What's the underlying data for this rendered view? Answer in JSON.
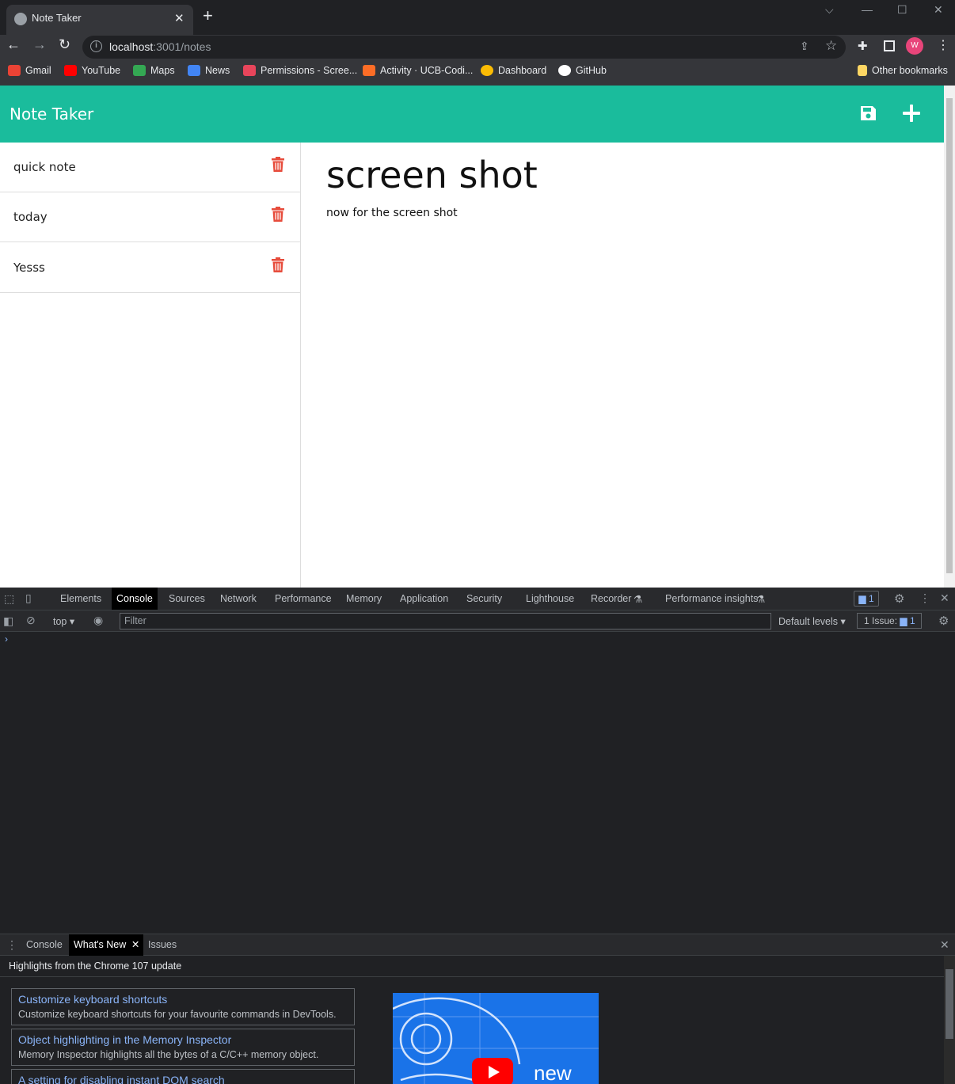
{
  "browser": {
    "tab_title": "Note Taker",
    "url_host": "localhost",
    "url_path": ":3001/notes",
    "profile_initial": "W",
    "bookmarks": [
      {
        "label": "Gmail",
        "color": "#ea4335"
      },
      {
        "label": "YouTube",
        "color": "#ff0000"
      },
      {
        "label": "Maps",
        "color": "#34a853"
      },
      {
        "label": "News",
        "color": "#4285f4"
      },
      {
        "label": "Permissions - Scree...",
        "color": "#e8455b"
      },
      {
        "label": "Activity · UCB-Codi...",
        "color": "#fc6d26"
      },
      {
        "label": "Dashboard",
        "color": "#fbbc04"
      },
      {
        "label": "GitHub",
        "color": "#ffffff"
      }
    ],
    "other_bookmarks": "Other bookmarks"
  },
  "app": {
    "brand": "Note Taker",
    "accent_color": "#1abc9c",
    "delete_color": "#e74c3c",
    "notes": [
      {
        "title": "quick note"
      },
      {
        "title": "today"
      },
      {
        "title": "Yesss"
      }
    ],
    "active_note": {
      "title": "screen shot",
      "text": "now for the screen shot"
    }
  },
  "devtools": {
    "tabs": [
      "Elements",
      "Console",
      "Sources",
      "Network",
      "Performance",
      "Memory",
      "Application",
      "Security",
      "Lighthouse",
      "Recorder",
      "Performance insights"
    ],
    "active_tab": "Console",
    "issues_badge": "1",
    "context": "top",
    "filter_placeholder": "Filter",
    "levels": "Default levels",
    "issues_label": "1 Issue:",
    "issues_count": "1",
    "prompt": "›",
    "drawer_tabs": [
      "Console",
      "What's New",
      "Issues"
    ],
    "drawer_active": "What's New",
    "drawer_heading": "Highlights from the Chrome 107 update",
    "features": [
      {
        "title": "Customize keyboard shortcuts",
        "desc": "Customize keyboard shortcuts for your favourite commands in DevTools."
      },
      {
        "title": "Object highlighting in the Memory Inspector",
        "desc": "Memory Inspector highlights all the bytes of a C/C++ memory object."
      },
      {
        "title": "A setting for disabling instant DOM search",
        "desc": ""
      }
    ],
    "promo_text": "new"
  }
}
